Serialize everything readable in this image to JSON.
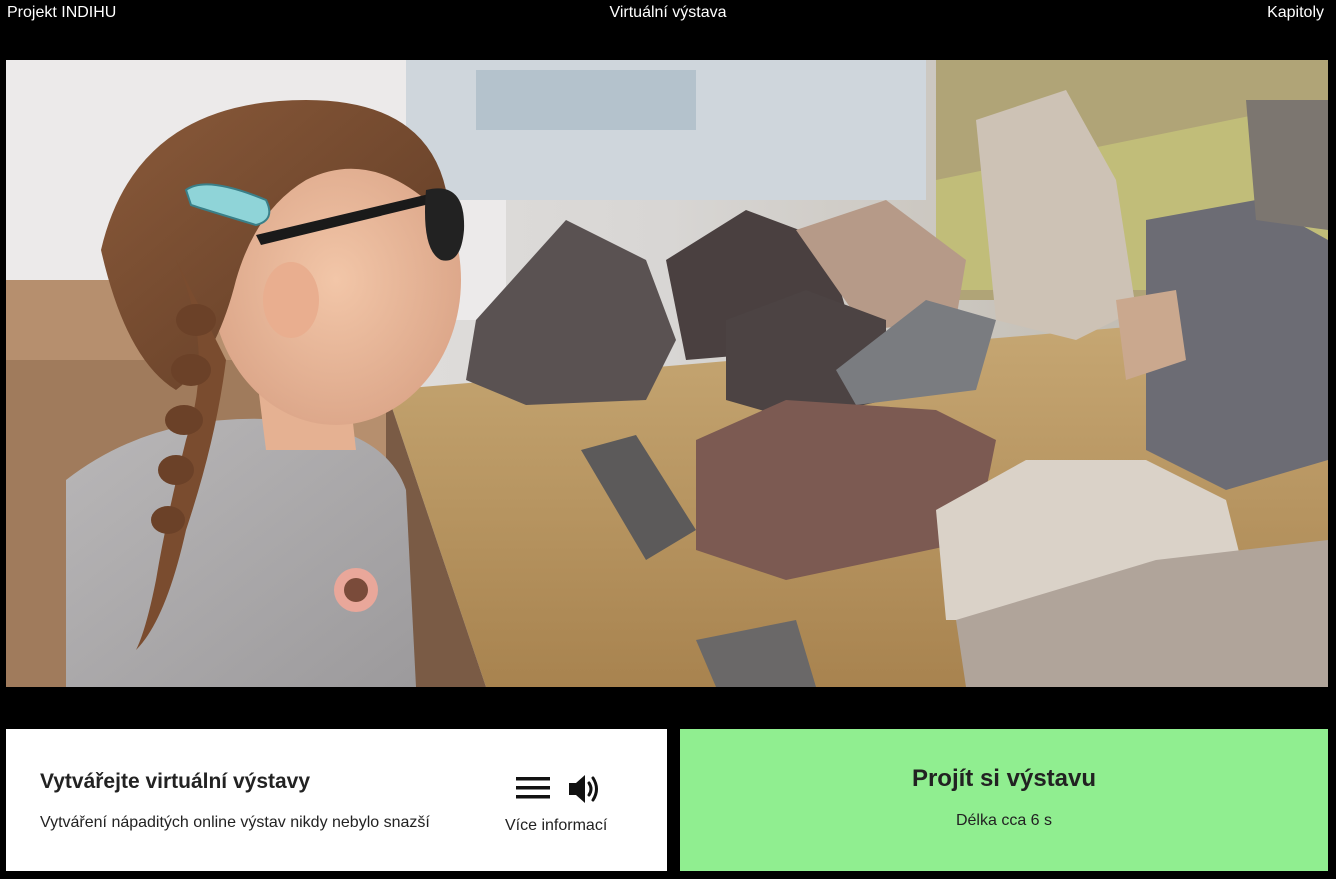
{
  "topbar": {
    "left_link": "Projekt INDIHU",
    "center_title": "Virtuální výstava",
    "right_link": "Kapitoly"
  },
  "hero": {
    "image_icon": "hero-photo-girl-looking-at-rocks"
  },
  "info_card": {
    "title": "Vytvářejte virtuální výstavy",
    "subtitle": "Vytváření nápaditých online výstav nikdy nebylo snazší",
    "menu_icon": "menu-icon",
    "sound_icon": "speaker-icon",
    "more_info_label": "Více informací"
  },
  "cta": {
    "title": "Projít si výstavu",
    "subtitle": "Délka cca 6 s",
    "color": "#90ee90"
  }
}
